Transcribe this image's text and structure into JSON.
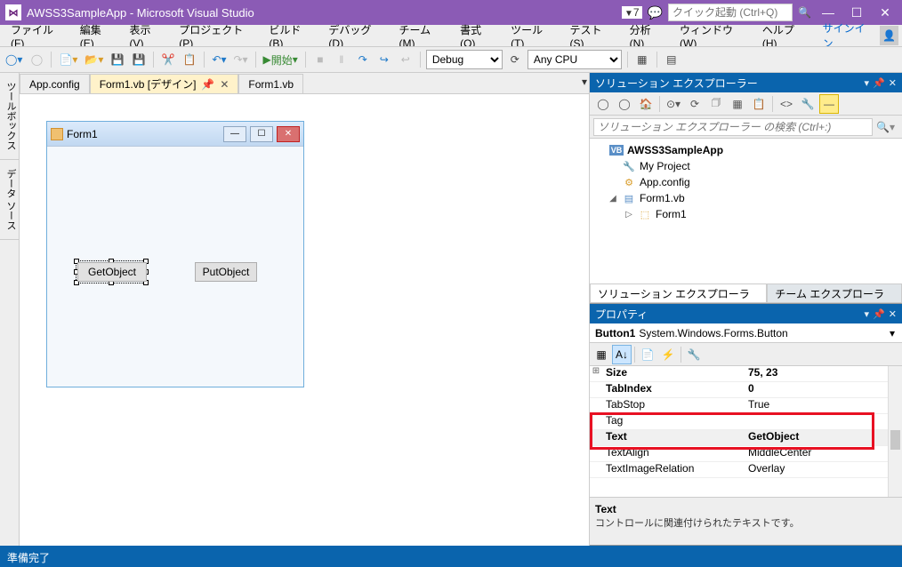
{
  "title": "AWSS3SampleApp - Microsoft Visual Studio",
  "notif_badge": "7",
  "quick_launch_placeholder": "クイック起動 (Ctrl+Q)",
  "menu": [
    "ファイル(F)",
    "編集(E)",
    "表示(V)",
    "プロジェクト(P)",
    "ビルド(B)",
    "デバッグ(D)",
    "チーム(M)",
    "書式(O)",
    "ツール(T)",
    "テスト(S)",
    "分析(N)",
    "ウィンドウ(W)",
    "ヘルプ(H)"
  ],
  "signin": "サインイン",
  "toolbar": {
    "start": "開始",
    "config": "Debug",
    "platform": "Any CPU"
  },
  "side_tabs": [
    "ツールボックス",
    "データ ソース"
  ],
  "doc_tabs": [
    {
      "label": "App.config",
      "active": false
    },
    {
      "label": "Form1.vb [デザイン]",
      "active": true
    },
    {
      "label": "Form1.vb",
      "active": false
    }
  ],
  "form": {
    "title": "Form1",
    "btn1": "GetObject",
    "btn2": "PutObject"
  },
  "sol_explorer": {
    "title": "ソリューション エクスプローラー",
    "search_placeholder": "ソリューション エクスプローラー の検索 (Ctrl+:)",
    "nodes": [
      {
        "label": "AWSS3SampleApp",
        "icon": "VB",
        "bold": true,
        "level": 0,
        "exp": ""
      },
      {
        "label": "My Project",
        "icon": "🔧",
        "level": 1,
        "exp": ""
      },
      {
        "label": "App.config",
        "icon": "📄",
        "level": 1,
        "exp": ""
      },
      {
        "label": "Form1.vb",
        "icon": "▤",
        "level": 1,
        "exp": "◢"
      },
      {
        "label": "Form1",
        "icon": "⬚",
        "level": 2,
        "exp": "▷"
      }
    ],
    "tabs": [
      "ソリューション エクスプローラー",
      "チーム エクスプローラー"
    ]
  },
  "properties": {
    "title": "プロパティ",
    "object_name": "Button1",
    "object_type": "System.Windows.Forms.Button",
    "rows": [
      {
        "exp": "⊞",
        "name": "Size",
        "val": "75, 23",
        "bold": true
      },
      {
        "exp": "",
        "name": "TabIndex",
        "val": "0",
        "bold": true
      },
      {
        "exp": "",
        "name": "TabStop",
        "val": "True"
      },
      {
        "exp": "",
        "name": "Tag",
        "val": ""
      },
      {
        "exp": "",
        "name": "Text",
        "val": "GetObject",
        "bold": true,
        "sel": true
      },
      {
        "exp": "",
        "name": "TextAlign",
        "val": "MiddleCenter"
      },
      {
        "exp": "",
        "name": "TextImageRelation",
        "val": "Overlay"
      }
    ],
    "desc_title": "Text",
    "desc_body": "コントロールに関連付けられたテキストです。"
  },
  "status": "準備完了"
}
